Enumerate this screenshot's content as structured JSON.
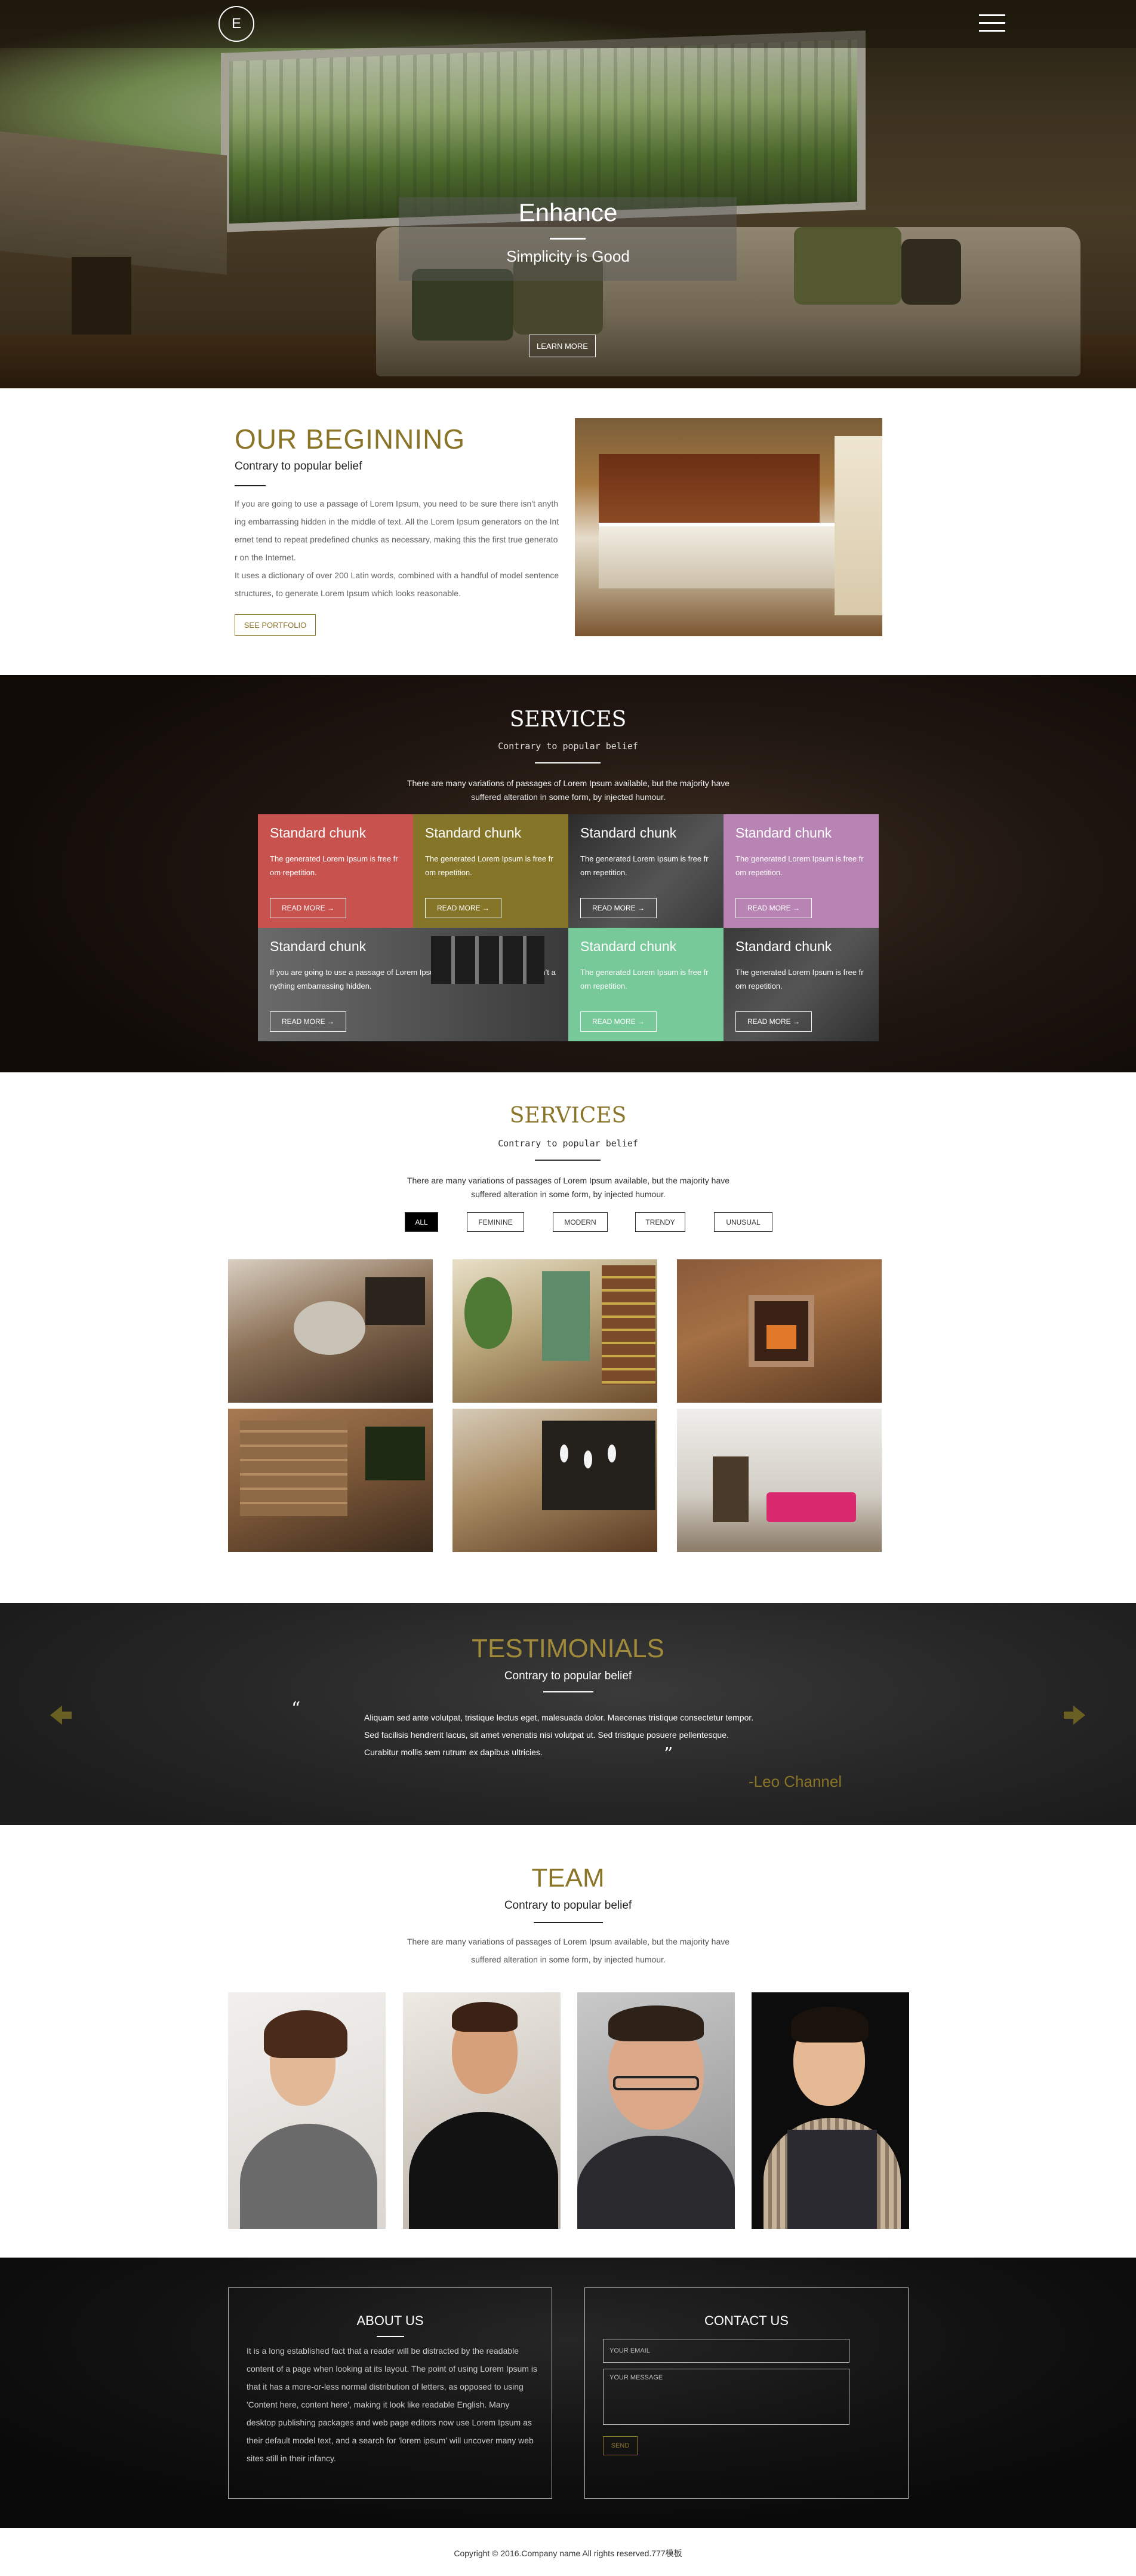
{
  "nav": {
    "logo_letter": "E",
    "menu_icon": "hamburger-menu-icon"
  },
  "hero": {
    "title": "Enhance",
    "subtitle": "Simplicity is Good",
    "button": "LEARN MORE"
  },
  "beginning": {
    "title": "OUR BEGINNING",
    "subtitle": "Contrary to popular belief",
    "paragraph_1": "If you are going to use a passage of Lorem Ipsum, you need to be sure there isn't anything embarrassing hidden in the middle of text. All the Lorem Ipsum generators on the Internet tend to repeat predefined chunks as necessary, making this the first true generator on the Internet.",
    "paragraph_2": "It uses a dictionary of over 200 Latin words, combined with a handful of model sentence structures, to generate Lorem Ipsum which looks reasonable.",
    "button": "SEE PORTFOLIO"
  },
  "services_dark": {
    "title": "SERVICES",
    "subtitle": "Contrary to popular belief",
    "description": "There are many variations of passages of Lorem Ipsum available, but the majority have suffered alteration in some form, by injected humour.",
    "cards": [
      {
        "title": "Standard chunk",
        "text": "The generated Lorem Ipsum is free from repetition.",
        "button": "READ MORE →",
        "color": "#c7524e"
      },
      {
        "title": "Standard chunk",
        "text": "The generated Lorem Ipsum is free from repetition.",
        "button": "READ MORE →",
        "color": "#857528"
      },
      {
        "title": "Standard chunk",
        "text": "The generated Lorem Ipsum is free from repetition.",
        "button": "READ MORE →",
        "color": "photo"
      },
      {
        "title": "Standard chunk",
        "text": "The generated Lorem Ipsum is free from repetition.",
        "button": "READ MORE →",
        "color": "#b884b4"
      },
      {
        "title": "Standard chunk",
        "text": "If you are going to use a passage of Lorem Ipsum, you need to be sure there isn't anything embarrassing hidden.",
        "button": "READ MORE →",
        "color": "photo"
      },
      {
        "title": "Standard chunk",
        "text": "The generated Lorem Ipsum is free from repetition.",
        "button": "READ MORE →",
        "color": "#78c99a"
      },
      {
        "title": "Standard chunk",
        "text": "The generated Lorem Ipsum is free from repetition.",
        "button": "READ MORE →",
        "color": "photo"
      }
    ]
  },
  "portfolio": {
    "title": "SERVICES",
    "subtitle": "Contrary to popular belief",
    "description": "There are many variations of passages of Lorem Ipsum available, but the majority have suffered alteration in some form, by injected humour.",
    "filters": [
      "ALL",
      "FEMININE",
      "MODERN",
      "TRENDY",
      "UNUSUAL"
    ],
    "active_filter": "ALL"
  },
  "testimonials": {
    "title": "TESTIMONIALS",
    "subtitle": "Contrary to popular belief",
    "quote_open": "“",
    "quote_close": "”",
    "quote": "Aliquam sed ante volutpat, tristique lectus eget, malesuada dolor. Maecenas tristique consectetur tempor. Sed facilisis hendrerit lacus, sit amet venenatis nisi volutpat ut. Sed tristique posuere pellentesque. Curabitur mollis sem rutrum ex dapibus ultricies.",
    "author": "-Leo Channel",
    "accent_color": "#8a7427"
  },
  "team": {
    "title": "TEAM",
    "subtitle": "Contrary to popular belief",
    "description": "There are many variations of passages of Lorem Ipsum available, but the majority have suffered alteration in some form, by injected humour."
  },
  "footer": {
    "about_title": "ABOUT US",
    "about_text": "It is a long established fact that a reader will be distracted by the readable content of a page when looking at its layout. The point of using Lorem Ipsum is that it has a more-or-less normal distribution of letters, as opposed to using 'Content here, content here', making it look like readable English. Many desktop publishing packages and web page editors now use Lorem Ipsum as their default model text, and a search for 'lorem ipsum' will uncover many web sites still in their infancy.",
    "contact_title": "CONTACT US",
    "email_placeholder": "YOUR EMAIL",
    "message_placeholder": "YOUR MESSAGE",
    "send_button": "SEND"
  },
  "copyright": "Copyright © 2016.Company name All rights reserved.777模板"
}
